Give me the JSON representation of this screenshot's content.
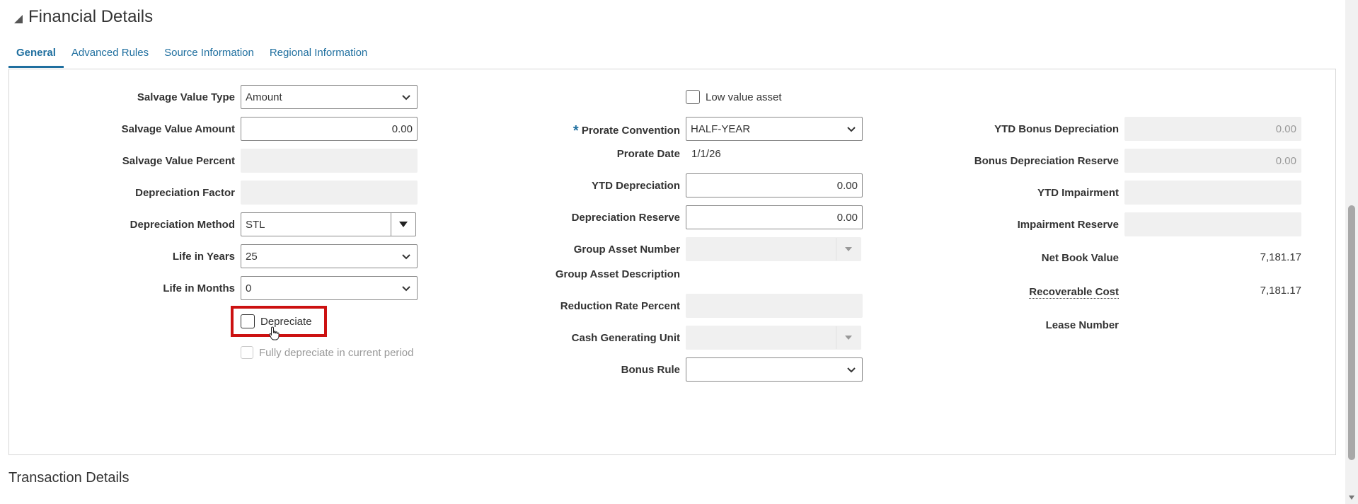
{
  "section": {
    "title": "Financial Details"
  },
  "tabs": [
    {
      "label": "General"
    },
    {
      "label": "Advanced Rules"
    },
    {
      "label": "Source Information"
    },
    {
      "label": "Regional Information"
    }
  ],
  "left": {
    "salvage_value_type": {
      "label": "Salvage Value Type",
      "value": "Amount"
    },
    "salvage_value_amount": {
      "label": "Salvage Value Amount",
      "value": "0.00"
    },
    "salvage_value_percent": {
      "label": "Salvage Value Percent",
      "value": ""
    },
    "depreciation_factor": {
      "label": "Depreciation Factor",
      "value": ""
    },
    "depreciation_method": {
      "label": "Depreciation Method",
      "value": "STL"
    },
    "life_in_years": {
      "label": "Life in Years",
      "value": "25"
    },
    "life_in_months": {
      "label": "Life in Months",
      "value": "0"
    },
    "depreciate": {
      "label": "Depreciate",
      "checked": false
    },
    "fully_depreciate": {
      "label": "Fully depreciate in current period",
      "checked": false
    }
  },
  "middle": {
    "low_value_asset": {
      "label": "Low value asset",
      "checked": false
    },
    "required_marker": "*",
    "prorate_convention": {
      "label": "Prorate Convention",
      "value": "HALF-YEAR"
    },
    "prorate_date": {
      "label": "Prorate Date",
      "value": "1/1/26"
    },
    "ytd_depreciation": {
      "label": "YTD Depreciation",
      "value": "0.00"
    },
    "depreciation_reserve": {
      "label": "Depreciation Reserve",
      "value": "0.00"
    },
    "group_asset_number": {
      "label": "Group Asset Number",
      "value": ""
    },
    "group_asset_description": {
      "label": "Group Asset Description",
      "value": ""
    },
    "reduction_rate_percent": {
      "label": "Reduction Rate Percent",
      "value": ""
    },
    "cash_generating_unit": {
      "label": "Cash Generating Unit",
      "value": ""
    },
    "bonus_rule": {
      "label": "Bonus Rule",
      "value": ""
    }
  },
  "right": {
    "ytd_bonus_depreciation": {
      "label": "YTD Bonus Depreciation",
      "value": "0.00"
    },
    "bonus_depreciation_reserve": {
      "label": "Bonus Depreciation Reserve",
      "value": "0.00"
    },
    "ytd_impairment": {
      "label": "YTD Impairment",
      "value": ""
    },
    "impairment_reserve": {
      "label": "Impairment Reserve",
      "value": ""
    },
    "net_book_value": {
      "label": "Net Book Value",
      "value": "7,181.17"
    },
    "recoverable_cost": {
      "label": "Recoverable Cost",
      "value": "7,181.17"
    },
    "lease_number": {
      "label": "Lease Number",
      "value": ""
    }
  },
  "transaction": {
    "title": "Transaction Details"
  },
  "colors": {
    "link": "#1f6f9f",
    "highlight": "#cc1111",
    "required": "#1f6f9f"
  }
}
